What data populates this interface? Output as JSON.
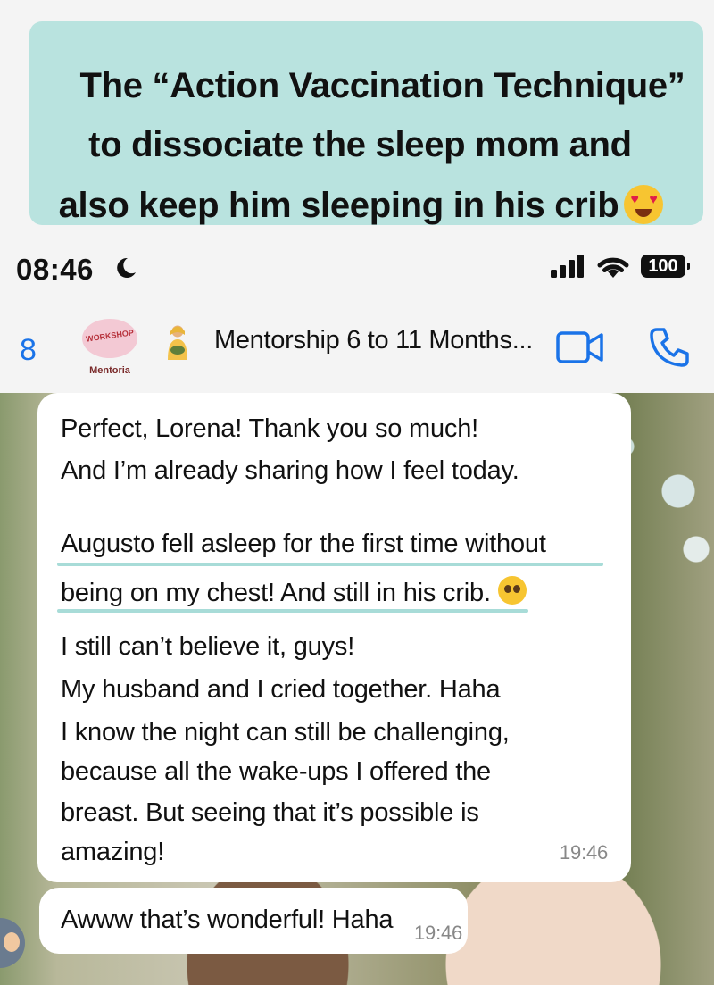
{
  "banner": {
    "line1": "The “Action Vaccination Technique”",
    "line2": "to dissociate the sleep mom and",
    "line3": "also keep him sleeping in his crib",
    "emoji": "heart-eyes-emoji"
  },
  "status_bar": {
    "time": "08:46",
    "focus_icon": "moon-icon",
    "battery": "100"
  },
  "chat_header": {
    "back_count": "8",
    "avatar_text": "WORKSHOP",
    "avatar_subtitle": "Mentoria",
    "title_emoji": "breastfeeding-woman-emoji",
    "title": "Mentorship 6 to 11 Months...",
    "video_icon": "video-camera-icon",
    "phone_icon": "phone-icon",
    "accent_color": "#1a73e8"
  },
  "messages": [
    {
      "lines": [
        "Perfect, Lorena! Thank you so much!",
        "And I’m already sharing how I feel today."
      ],
      "highlighted": [
        "Augusto fell asleep for the first time without",
        "being on my chest! And still in his crib."
      ],
      "highlight_emoji": "pleading-face-emoji",
      "lines2": [
        "I still can’t believe it, guys!",
        "My husband and I cried together. Haha",
        "I know the night can still be challenging,",
        "because all the wake-ups I offered the",
        "breast. But seeing that it’s possible is",
        "amazing!"
      ],
      "time": "19:46"
    },
    {
      "text": "Awww that’s wonderful! Haha",
      "time": "19:46"
    }
  ]
}
